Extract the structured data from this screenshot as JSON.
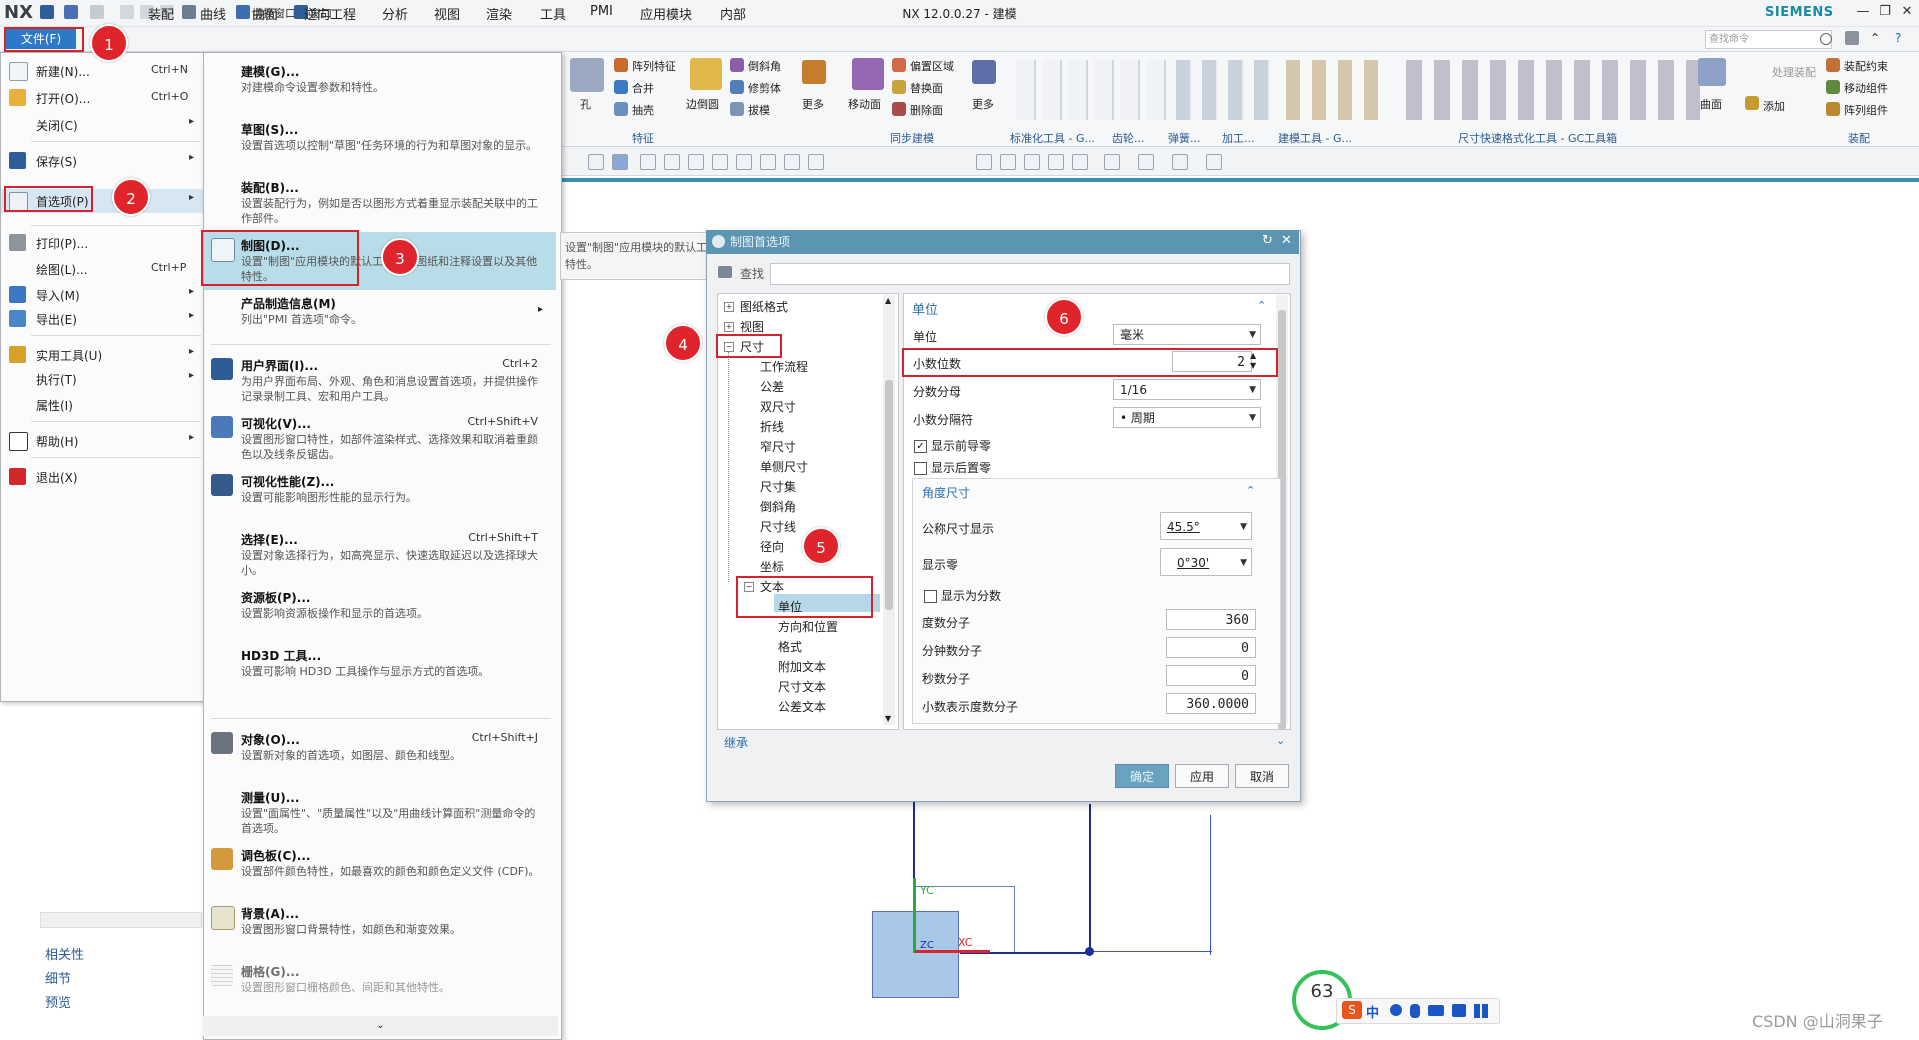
{
  "titlebar": {
    "logo": "NX",
    "switch_window": "切换窗口",
    "window": "窗口",
    "title": "NX 12.0.0.27 - 建模",
    "brand": "SIEMENS"
  },
  "menubar": {
    "file": "文件(F)",
    "items": [
      "装配",
      "曲线",
      "曲面",
      "逆向工程",
      "分析",
      "视图",
      "渲染",
      "工具",
      "PMI",
      "应用模块",
      "内部"
    ],
    "search_placeholder": "查找命令"
  },
  "ribbon": {
    "labels": {
      "hole": "孔",
      "pattern_feature": "阵列特征",
      "combine": "合并",
      "shell": "抽壳",
      "edge_blend": "边倒圆",
      "chamfer": "倒斜角",
      "trim_body": "修剪体",
      "draft": "拔模",
      "more1": "更多",
      "move_face": "移动面",
      "offset_region": "偏置区域",
      "replace_face": "替换面",
      "delete_face": "删除面",
      "more2": "更多",
      "surface": "曲面",
      "add": "添加",
      "assembly_constraint": "装配约束",
      "move_component": "移动组件",
      "pattern_component": "阵列组件",
      "process_assembly": "处理装配"
    },
    "groups": {
      "feature": "特征",
      "sync_modeling": "同步建模",
      "std_tools": "标准化工具 - G...",
      "gear": "齿轮...",
      "spring": "弹簧...",
      "machining": "加工...",
      "modeling_tools": "建模工具 - G...",
      "dim_format": "尺寸快速格式化工具 - GC工具箱",
      "assembly": "装配"
    }
  },
  "file_menu": {
    "items": [
      {
        "label": "新建(N)...",
        "shortcut": "Ctrl+N",
        "arrow": ""
      },
      {
        "label": "打开(O)...",
        "shortcut": "Ctrl+O",
        "arrow": ""
      },
      {
        "label": "关闭(C)",
        "shortcut": "",
        "arrow": "▸"
      },
      {
        "label": "保存(S)",
        "shortcut": "",
        "arrow": "▸"
      },
      {
        "label": "首选项(P)",
        "shortcut": "",
        "arrow": "▸"
      },
      {
        "label": "打印(P)...",
        "shortcut": "",
        "arrow": ""
      },
      {
        "label": "绘图(L)...",
        "shortcut": "Ctrl+P",
        "arrow": ""
      },
      {
        "label": "导入(M)",
        "shortcut": "",
        "arrow": "▸"
      },
      {
        "label": "导出(E)",
        "shortcut": "",
        "arrow": "▸"
      },
      {
        "label": "实用工具(U)",
        "shortcut": "",
        "arrow": "▸"
      },
      {
        "label": "执行(T)",
        "shortcut": "",
        "arrow": "▸"
      },
      {
        "label": "属性(I)",
        "shortcut": "",
        "arrow": ""
      },
      {
        "label": "帮助(H)",
        "shortcut": "",
        "arrow": "▸"
      },
      {
        "label": "退出(X)",
        "shortcut": "",
        "arrow": ""
      }
    ]
  },
  "pref_menu": {
    "items": [
      {
        "title": "建模(G)...",
        "shortcut": "",
        "desc": "对建模命令设置参数和特性。"
      },
      {
        "title": "草图(S)...",
        "shortcut": "",
        "desc": "设置首选项以控制\"草图\"任务环境的行为和草图对象的显示。"
      },
      {
        "title": "装配(B)...",
        "shortcut": "",
        "desc": "设置装配行为，例如是否以图形方式着重显示装配关联中的工作部件。"
      },
      {
        "title": "制图(D)...",
        "shortcut": "",
        "desc": "设置\"制图\"应用模块的默认工作流、图纸和注释设置以及其他特性。"
      },
      {
        "title": "产品制造信息(M)",
        "shortcut": "",
        "desc": "列出\"PMI 首选项\"命令。"
      },
      {
        "title": "用户界面(I)...",
        "shortcut": "Ctrl+2",
        "desc": "为用户界面布局、外观、角色和消息设置首选项，并提供操作记录录制工具、宏和用户工具。"
      },
      {
        "title": "可视化(V)...",
        "shortcut": "Ctrl+Shift+V",
        "desc": "设置图形窗口特性，如部件渲染样式、选择效果和取消着重颜色以及线条反锯齿。"
      },
      {
        "title": "可视化性能(Z)...",
        "shortcut": "",
        "desc": "设置可能影响图形性能的显示行为。"
      },
      {
        "title": "选择(E)...",
        "shortcut": "Ctrl+Shift+T",
        "desc": "设置对象选择行为，如高亮显示、快速选取延迟以及选择球大小。"
      },
      {
        "title": "资源板(P)...",
        "shortcut": "",
        "desc": "设置影响资源板操作和显示的首选项。"
      },
      {
        "title": "HD3D 工具...",
        "shortcut": "",
        "desc": "设置可影响 HD3D 工具操作与显示方式的首选项。"
      },
      {
        "title": "对象(O)...",
        "shortcut": "Ctrl+Shift+J",
        "desc": "设置新对象的首选项，如图层、颜色和线型。"
      },
      {
        "title": "测量(U)...",
        "shortcut": "",
        "desc": "设置\"面属性\"、\"质量属性\"以及\"用曲线计算面积\"测量命令的首选项。"
      },
      {
        "title": "调色板(C)...",
        "shortcut": "",
        "desc": "设置部件颜色特性，如最喜欢的颜色和颜色定义文件 (CDF)。"
      },
      {
        "title": "背景(A)...",
        "shortcut": "",
        "desc": "设置图形窗口背景特性，如颜色和渐变效果。"
      },
      {
        "title": "栅格(G)...",
        "shortcut": "",
        "desc": "设置图形窗口栅格颜色、间距和其他特性。"
      }
    ],
    "tooltip": "设置\"制图\"应用模块的默认工作流、图纸和注释设置以及其他特性。"
  },
  "dialog": {
    "title": "制图首选项",
    "find_label": "查找",
    "tree": [
      {
        "label": "图纸格式",
        "pm": "+"
      },
      {
        "label": "视图",
        "pm": "+"
      },
      {
        "label": "尺寸",
        "pm": "−"
      },
      {
        "label": "工作流程",
        "pm": ""
      },
      {
        "label": "公差",
        "pm": ""
      },
      {
        "label": "双尺寸",
        "pm": ""
      },
      {
        "label": "折线",
        "pm": ""
      },
      {
        "label": "窄尺寸",
        "pm": ""
      },
      {
        "label": "单侧尺寸",
        "pm": ""
      },
      {
        "label": "尺寸集",
        "pm": ""
      },
      {
        "label": "倒斜角",
        "pm": ""
      },
      {
        "label": "尺寸线",
        "pm": ""
      },
      {
        "label": "径向",
        "pm": ""
      },
      {
        "label": "坐标",
        "pm": ""
      },
      {
        "label": "文本",
        "pm": "−"
      },
      {
        "label": "单位",
        "pm": ""
      },
      {
        "label": "方向和位置",
        "pm": ""
      },
      {
        "label": "格式",
        "pm": ""
      },
      {
        "label": "附加文本",
        "pm": ""
      },
      {
        "label": "尺寸文本",
        "pm": ""
      },
      {
        "label": "公差文本",
        "pm": ""
      }
    ],
    "units_section": "单位",
    "unit_label": "单位",
    "unit_value": "毫米",
    "decimal_places_label": "小数位数",
    "decimal_places_value": "2",
    "fraction_denominator_label": "分数分母",
    "fraction_denominator_value": "1/16",
    "decimal_separator_label": "小数分隔符",
    "decimal_separator_value": "• 周期",
    "show_leading_zeros_label": "显示前导零",
    "show_leading_zeros_checked": true,
    "show_trailing_zeros_label": "显示后置零",
    "show_trailing_zeros_checked": false,
    "angle_section": "角度尺寸",
    "nominal_display_label": "公称尺寸显示",
    "nominal_display_value": "45.5°",
    "show_zero_label": "显示零",
    "show_zero_value": "0°30'",
    "show_as_fraction_label": "显示为分数",
    "show_as_fraction_checked": false,
    "degree_numerator_label": "度数分子",
    "degree_numerator_value": "360",
    "minute_numerator_label": "分钟数分子",
    "minute_numerator_value": "0",
    "second_numerator_label": "秒数分子",
    "second_numerator_value": "0",
    "decimal_degree_numerator_label": "小数表示度数分子",
    "decimal_degree_numerator_value": "360.0000",
    "inherit_label": "继承",
    "ok": "确定",
    "apply": "应用",
    "cancel": "取消"
  },
  "resource_bar": {
    "links": [
      "相关性",
      "细节",
      "预览"
    ]
  },
  "annotations": [
    "1",
    "2",
    "3",
    "4",
    "5",
    "6"
  ],
  "canvas": {
    "yc": "YC",
    "xc": "XC",
    "zc": "ZC"
  },
  "ime": {
    "counter": "63",
    "lang": "中"
  },
  "watermark": "CSDN @山洞果子",
  "colors": {
    "accent": "#2e78c8",
    "dialog_header": "#5c95b2",
    "highlight": "#b9dde8",
    "annotation_red": "#e0242b"
  }
}
